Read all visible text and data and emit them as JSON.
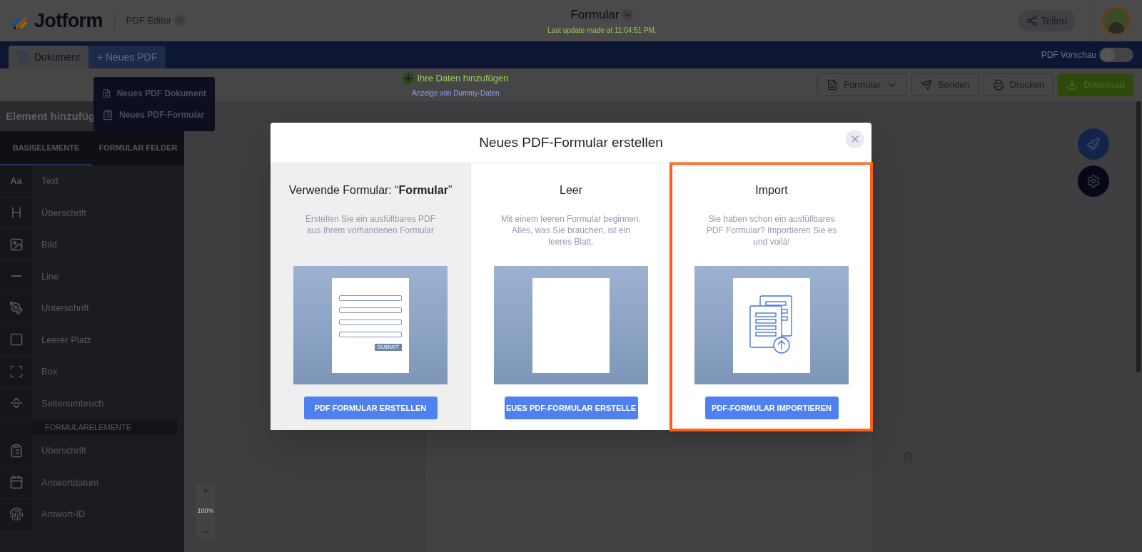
{
  "header": {
    "logo": "Jotform",
    "product": "PDF Editor",
    "title": "Formular",
    "last_update": "Last update made at 11:04:51 PM.",
    "share_button": "Teilen"
  },
  "tabs": [
    {
      "label": "Dokument",
      "selected": true
    },
    {
      "label": "+ Neues PDF",
      "selected": false
    }
  ],
  "new_pdf_menu": [
    {
      "label": "Neues PDF Dokument",
      "kind": "doc"
    },
    {
      "label": "Neues PDF-Formular",
      "kind": "form"
    }
  ],
  "pdf_preview": {
    "label": "PDF Vorschau",
    "on": false
  },
  "data_bar": {
    "add_data": "Ihre Daten hinzufügen",
    "dummy_link": "Anzeige von Dummy-Daten"
  },
  "toolbar": [
    {
      "label": "Formular",
      "kind": "dropdown"
    },
    {
      "label": "Senden",
      "kind": "send"
    },
    {
      "label": "Drucken",
      "kind": "print"
    },
    {
      "label": "Download",
      "kind": "download"
    }
  ],
  "sidebar": {
    "title": "Element hinzufüg",
    "tabs": [
      {
        "label": "BASISELEMENTE",
        "selected": true
      },
      {
        "label": "FORMULAR FELDER",
        "selected": false
      }
    ],
    "items": [
      {
        "kind": "text",
        "label": "Text",
        "icon_text": "Aa"
      },
      {
        "kind": "heading",
        "label": "Überschrift"
      },
      {
        "kind": "image",
        "label": "Bild"
      },
      {
        "kind": "line",
        "label": "Line"
      },
      {
        "kind": "signature",
        "label": "Unterschrift"
      },
      {
        "kind": "blank",
        "label": "Leerer Platz"
      },
      {
        "kind": "box",
        "label": "Box"
      },
      {
        "kind": "pagebreak",
        "label": "Seitenumbruch"
      },
      {
        "kind": "section",
        "label": "FORMULARELEMENTE"
      },
      {
        "kind": "form-heading",
        "label": "Überschrift"
      },
      {
        "kind": "date",
        "label": "Antwortdatum"
      },
      {
        "kind": "id",
        "label": "Antwort-ID"
      }
    ]
  },
  "zoom": {
    "level": "100%"
  },
  "modal": {
    "title": "Neues PDF-Formular erstellen",
    "options": [
      {
        "kind": "form",
        "title": "Verwende Formular: “**Formular**”",
        "description": "Erstellen Sie ein ausfüllbares PDF aus Ihrem vorhandenen Formular",
        "button": "PDF FORMULAR ERSTELLEN",
        "submit_label": "SUBMIT",
        "hovered": true,
        "highlighted": false
      },
      {
        "kind": "blank",
        "title": "Leer",
        "description": "Mit einem leeren Formular beginnen. Alles, was Sie brauchen, ist ein leeres Blatt.",
        "button": "EUES PDF-FORMULAR ERSTELLE",
        "hovered": false,
        "highlighted": false
      },
      {
        "kind": "import",
        "title": "Import",
        "description": "Sie haben schon ein ausfüllbares PDF Formular? Importieren Sie es und voilà!",
        "button": "PDF-FORMULAR IMPORTIEREN",
        "hovered": false,
        "highlighted": true
      }
    ]
  }
}
